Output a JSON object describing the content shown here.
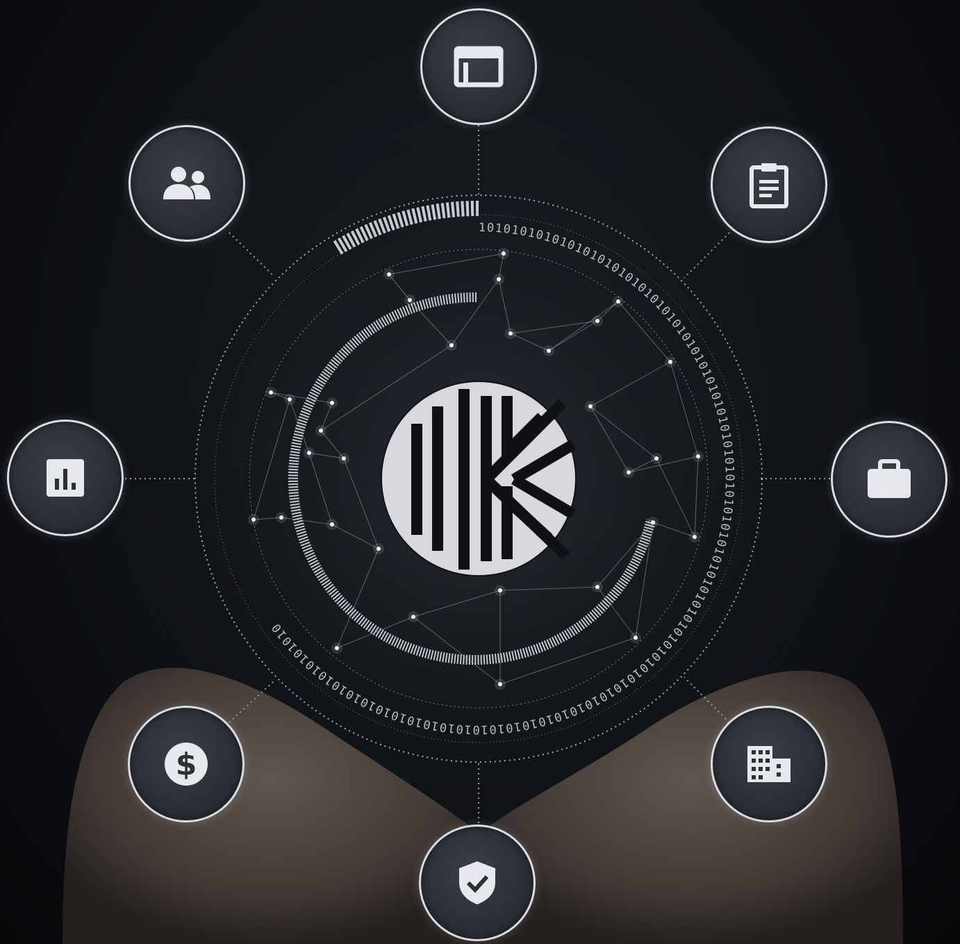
{
  "ring": {
    "binary_text": "1010101010101010101010101010101010101010101010101010101010101010101010101010101010101010101010101010101010101010101010101010"
  },
  "center_logo": {
    "icon": "keeper-k-logo",
    "color": "#d7d9dc"
  },
  "nodes": [
    {
      "id": "top",
      "icon": "browser-window-icon"
    },
    {
      "id": "top-right",
      "icon": "clipboard-icon"
    },
    {
      "id": "right",
      "icon": "briefcase-icon"
    },
    {
      "id": "bottom-right",
      "icon": "office-building-icon"
    },
    {
      "id": "bottom",
      "icon": "shield-check-icon"
    },
    {
      "id": "bottom-left",
      "icon": "dollar-icon"
    },
    {
      "id": "left",
      "icon": "bar-chart-icon"
    },
    {
      "id": "top-left",
      "icon": "users-icon"
    }
  ],
  "colors": {
    "icon": "#e6e8eb",
    "ring": "#cfd3d8",
    "background": "#0b0d10"
  }
}
